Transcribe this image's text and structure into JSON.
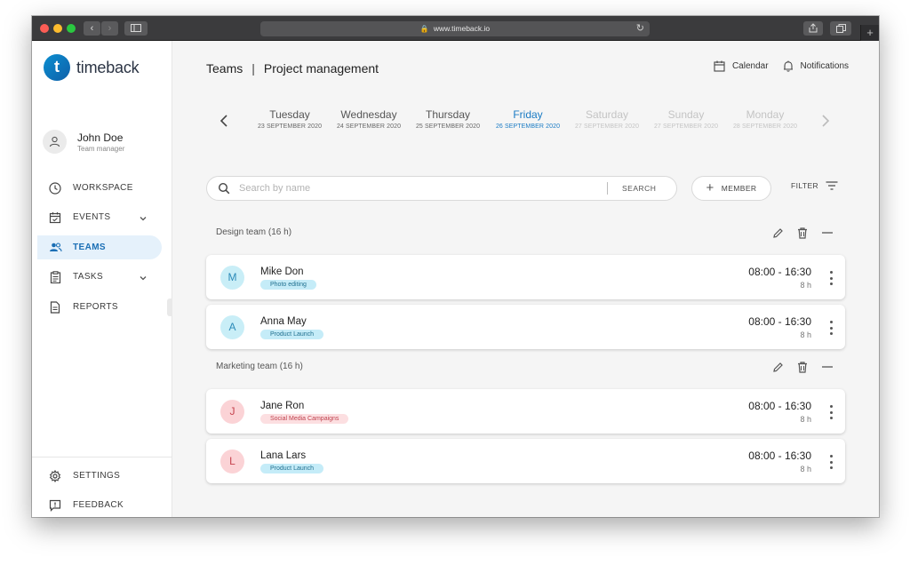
{
  "browser": {
    "url": "www.timeback.io",
    "icons": [
      "back-icon",
      "forward-icon",
      "sidebar-icon",
      "lock-icon",
      "reload-icon",
      "share-icon",
      "tabs-icon",
      "plus-icon"
    ]
  },
  "app": {
    "logo_letter": "t",
    "name": "timeback",
    "brand_color": "#0f7cc4"
  },
  "user": {
    "name": "John Doe",
    "role": "Team manager"
  },
  "sidebar": {
    "items": [
      {
        "label": "WORKSPACE",
        "icon": "clock-icon",
        "active": false
      },
      {
        "label": "EVENTS",
        "icon": "calendar-check-icon",
        "active": false,
        "expandable": true
      },
      {
        "label": "TEAMS",
        "icon": "people-icon",
        "active": true
      },
      {
        "label": "TASKS",
        "icon": "clipboard-icon",
        "active": false,
        "expandable": true
      },
      {
        "label": "REPORTS",
        "icon": "document-icon",
        "active": false
      }
    ],
    "bottom": [
      {
        "label": "SETTINGS",
        "icon": "gear-icon"
      },
      {
        "label": "FEEDBACK",
        "icon": "feedback-icon"
      }
    ]
  },
  "header": {
    "section": "Teams",
    "separator": "|",
    "page": "Project management",
    "calendar_label": "Calendar",
    "notifications_label": "Notifications"
  },
  "days": [
    {
      "name": "Tuesday",
      "date": "23 SEPTEMBER 2020",
      "state": "normal"
    },
    {
      "name": "Wednesday",
      "date": "24 SEPTEMBER 2020",
      "state": "normal"
    },
    {
      "name": "Thursday",
      "date": "25 SEPTEMBER 2020",
      "state": "normal"
    },
    {
      "name": "Friday",
      "date": "26 SEPTEMBER 2020",
      "state": "active"
    },
    {
      "name": "Saturday",
      "date": "27 SEPTEMBER 2020",
      "state": "muted"
    },
    {
      "name": "Sunday",
      "date": "27 SEPTEMBER 2020",
      "state": "muted"
    },
    {
      "name": "Monday",
      "date": "28 SEPTEMBER 2020",
      "state": "muted"
    }
  ],
  "toolbar": {
    "search_placeholder": "Search by name",
    "search_button": "SEARCH",
    "member_button": "MEMBER",
    "filter_button": "FILTER"
  },
  "teams": [
    {
      "title": "Design team (16 h)",
      "members": [
        {
          "initial": "M",
          "name": "Mike Don",
          "tag": "Photo editing",
          "color": "blue",
          "time": "08:00 - 16:30",
          "hours": "8 h"
        },
        {
          "initial": "A",
          "name": "Anna May",
          "tag": "Product Launch",
          "color": "blue",
          "time": "08:00 - 16:30",
          "hours": "8 h"
        }
      ]
    },
    {
      "title": "Marketing team (16 h)",
      "members": [
        {
          "initial": "J",
          "name": "Jane Ron",
          "tag": "Social Media Campaigns",
          "color": "red",
          "time": "08:00 - 16:30",
          "hours": "8 h"
        },
        {
          "initial": "L",
          "name": "Lana Lars",
          "tag": "Product Launch",
          "color": "blue",
          "time": "08:00 - 16:30",
          "hours": "8 h"
        }
      ]
    }
  ],
  "colors": {
    "accent": "#1a7bc4",
    "active_bg": "#e5f1fb",
    "tag_blue": "#c5ecf8",
    "tag_red": "#fcdfe1"
  }
}
